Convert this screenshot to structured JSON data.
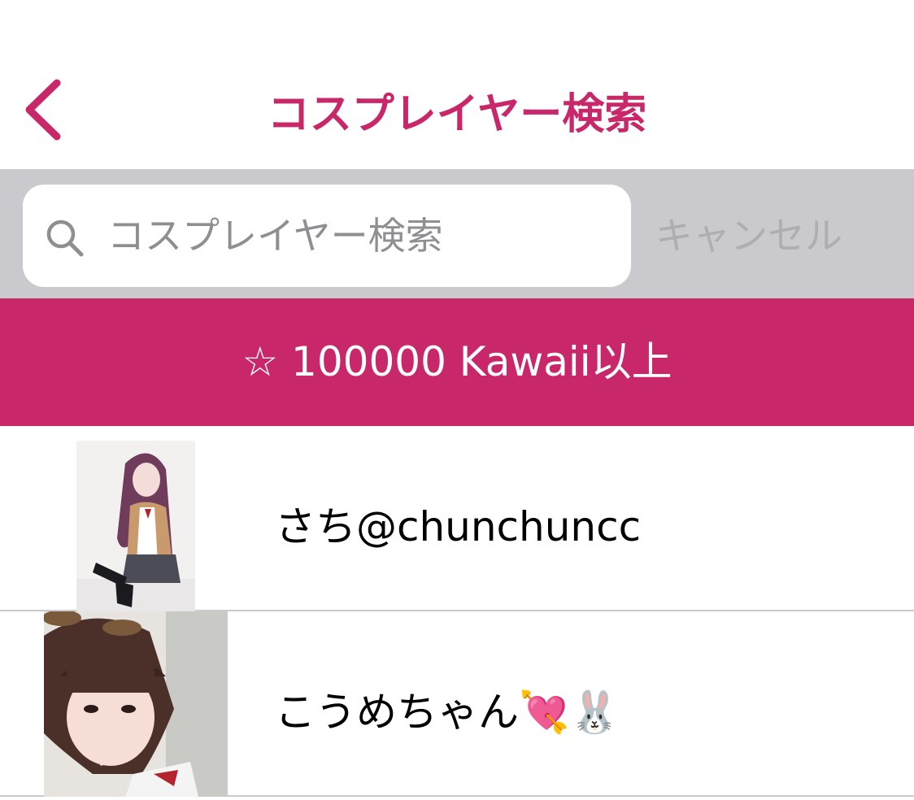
{
  "navbar": {
    "title": "コスプレイヤー検索",
    "back_icon": "chevron-left-icon"
  },
  "search": {
    "placeholder": "コスプレイヤー検索",
    "value": "",
    "cancel_label": "キャンセル",
    "icon": "search-icon"
  },
  "filter": {
    "label": "☆ 100000 Kawaii以上"
  },
  "results": [
    {
      "name": "さち@chunchuncc",
      "avatar": "avatar-photo"
    },
    {
      "name": "こうめちゃん💘🐰",
      "avatar": "avatar-photo"
    }
  ],
  "colors": {
    "accent": "#c8286a",
    "search_bar_bg": "#c9c9ce",
    "placeholder": "#8e8e93",
    "cancel": "#adadb2"
  }
}
